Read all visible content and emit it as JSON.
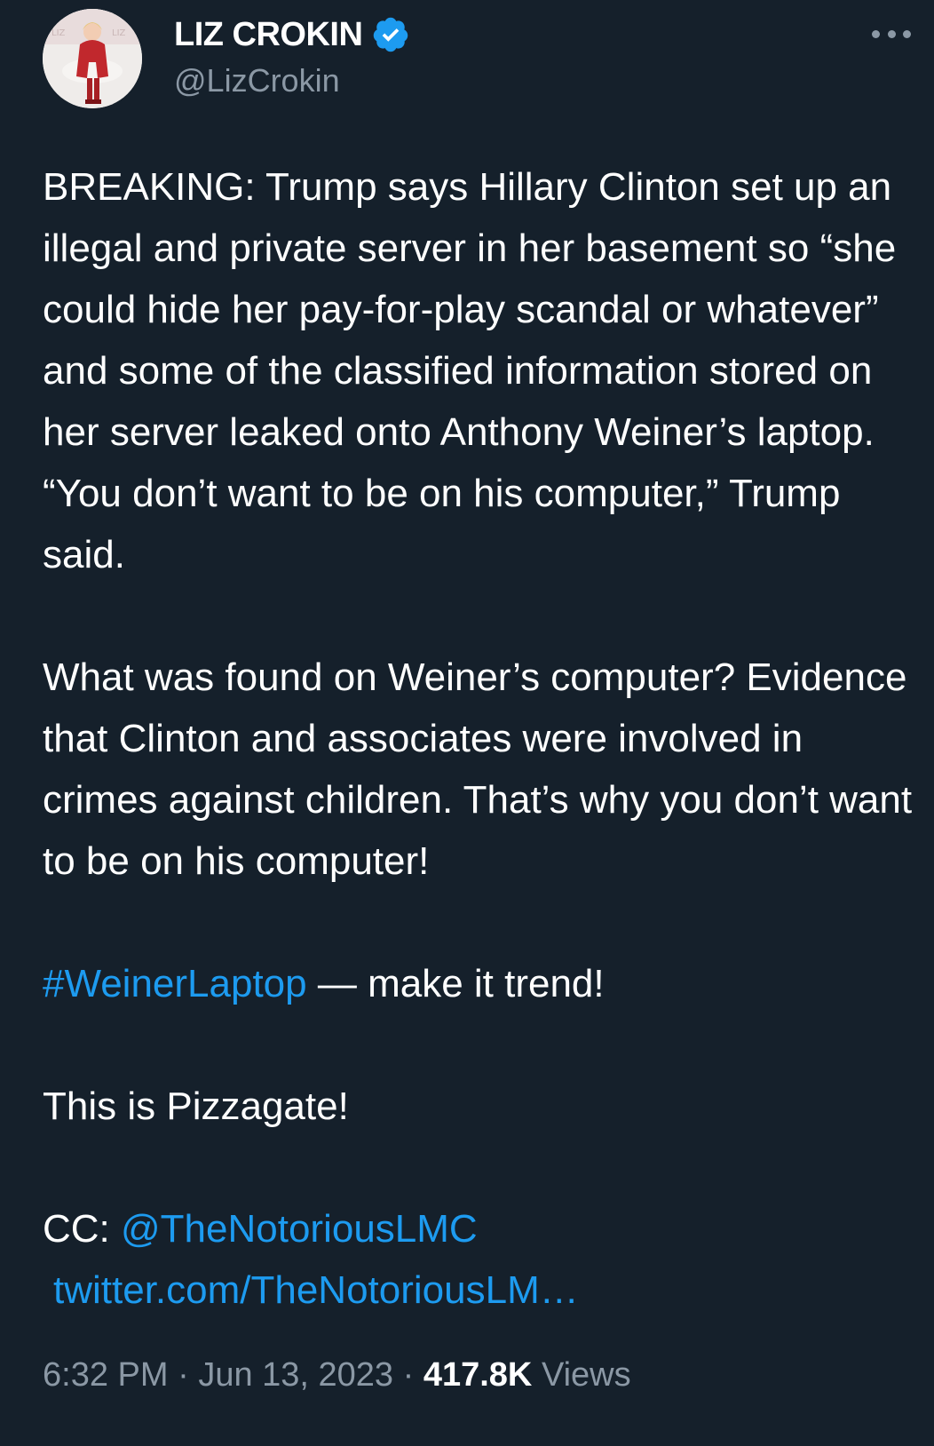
{
  "author": {
    "display_name": "LIZ CROKIN",
    "handle": "@LizCrokin",
    "verified": true,
    "avatar_icon": "profile-photo-woman-red-suit",
    "verified_icon": "verified-badge-icon"
  },
  "menu": {
    "icon": "more-options-icon"
  },
  "tweet": {
    "paragraph1": "BREAKING: Trump says Hillary Clinton set up an illegal and private server in her basement so “she could hide her pay-for-play scandal or whatever” and some of the classified information stored on her server leaked onto Anthony Weiner’s laptop. “You don’t want to be on his computer,” Trump said.",
    "paragraph2": "What was found on Weiner’s computer? Evidence that Clinton and associates were involved in crimes against children. That’s why you don’t want to be on his computer!",
    "hashtag": "#WeinerLaptop",
    "hashtag_suffix": " — make it trend!",
    "paragraph4": "This is Pizzagate!",
    "cc_prefix": "CC: ",
    "cc_mention": "@TheNotoriousLMC",
    "url": "twitter.com/TheNotoriousLM…"
  },
  "meta": {
    "time": "6:32 PM",
    "separator": " · ",
    "date": "Jun 13, 2023",
    "views_count": "417.8K",
    "views_label": " Views"
  },
  "colors": {
    "background": "#15202b",
    "text": "#ffffff",
    "secondary": "#8b98a5",
    "link": "#1d9bf0",
    "verified": "#1d9bf0"
  }
}
